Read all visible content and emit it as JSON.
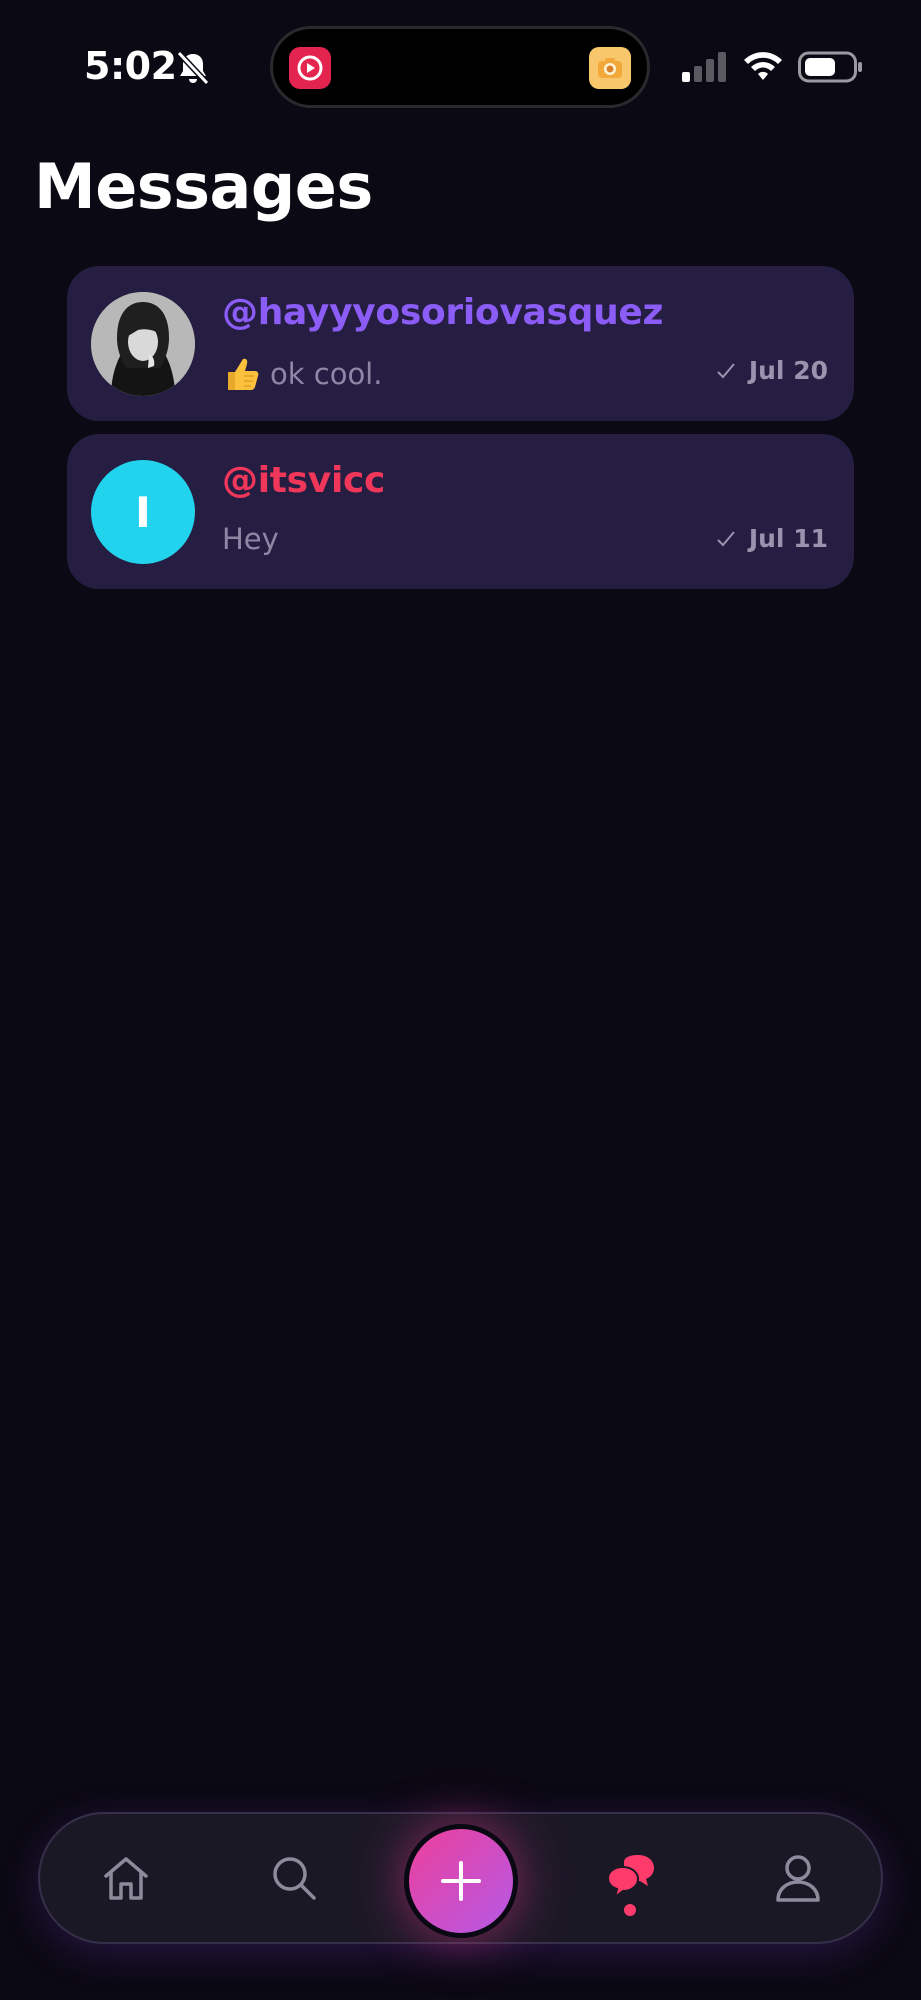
{
  "status_bar": {
    "time": "5:02",
    "icons": [
      "bell-slash-icon",
      "signal-icon",
      "wifi-icon",
      "battery-icon"
    ],
    "island_apps": [
      "video-app-icon",
      "camera-app-icon"
    ]
  },
  "page": {
    "title": "Messages"
  },
  "conversations": [
    {
      "handle": "@hayyyosoriovasquez",
      "handle_color": "#8b5cf6",
      "preview_emoji": "thumbs-up-icon",
      "preview": "ok cool.",
      "date": "Jul 20",
      "avatar": "photo"
    },
    {
      "handle": "@itsvicc",
      "handle_color": "#f0375a",
      "preview": "Hey",
      "date": "Jul 11",
      "avatar_initial": "I",
      "avatar_color": "#22d3ee"
    }
  ],
  "nav": {
    "items": [
      "home-icon",
      "search-icon",
      "add-icon",
      "messages-icon",
      "profile-icon"
    ],
    "active": "messages-icon",
    "accent": "#ff3b6b"
  }
}
